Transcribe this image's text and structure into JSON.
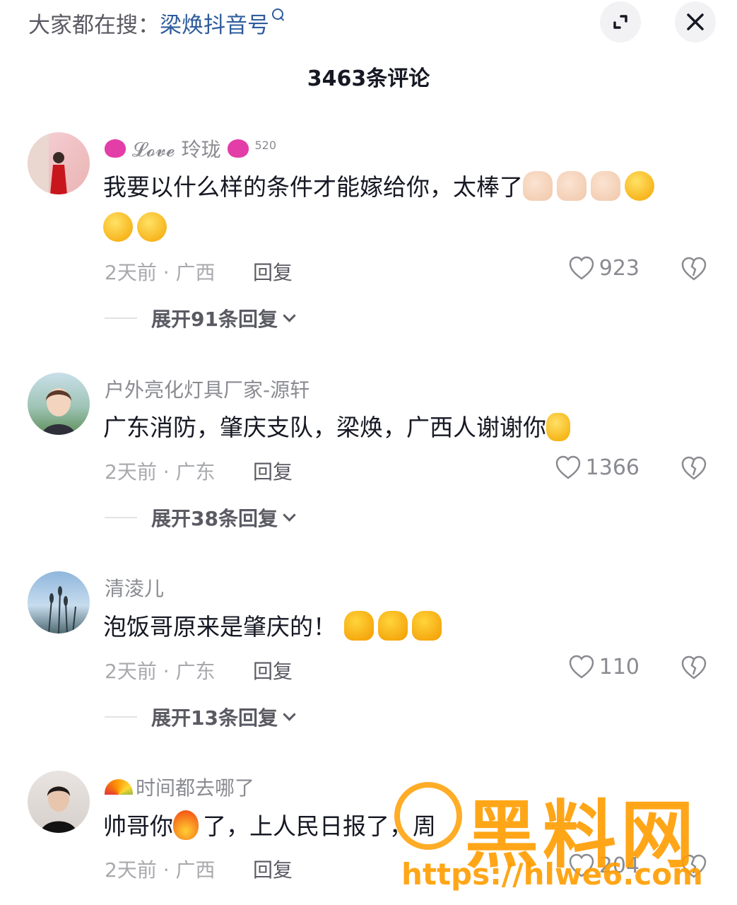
{
  "header": {
    "search_prefix": "大家都在搜：",
    "search_term": "梁焕抖音号",
    "comment_count_title": "3463条评论"
  },
  "comments": [
    {
      "username": "𝓛𝓸𝓿𝓮 玲珑",
      "username_suffix": "520",
      "text": "我要以什么样的条件才能嫁给你，太棒了",
      "time_location": "2天前 · 广西",
      "reply_label": "回复",
      "likes": "923",
      "expand_label": "展开91条回复"
    },
    {
      "username": "户外亮化灯具厂家-源轩",
      "text": "广东消防，肇庆支队，梁焕，广西人谢谢你",
      "time_location": "2天前 · 广东",
      "reply_label": "回复",
      "likes": "1366",
      "expand_label": "展开38条回复"
    },
    {
      "username": "清淩儿",
      "text": "泡饭哥原来是肇庆的！",
      "time_location": "2天前 · 广东",
      "reply_label": "回复",
      "likes": "110",
      "expand_label": "展开13条回复"
    },
    {
      "username": "时间都去哪了",
      "text_a": "帅哥你",
      "text_b": "了，上人民日报了，周",
      "time_location": "2天前 · 广西",
      "reply_label": "回复",
      "likes": "204"
    }
  ],
  "watermark": {
    "title": "黑料网",
    "url": "https://hlwe6.com"
  },
  "colors": {
    "link_blue": "#2f5c9c",
    "watermark_orange": "#ff9d00"
  }
}
